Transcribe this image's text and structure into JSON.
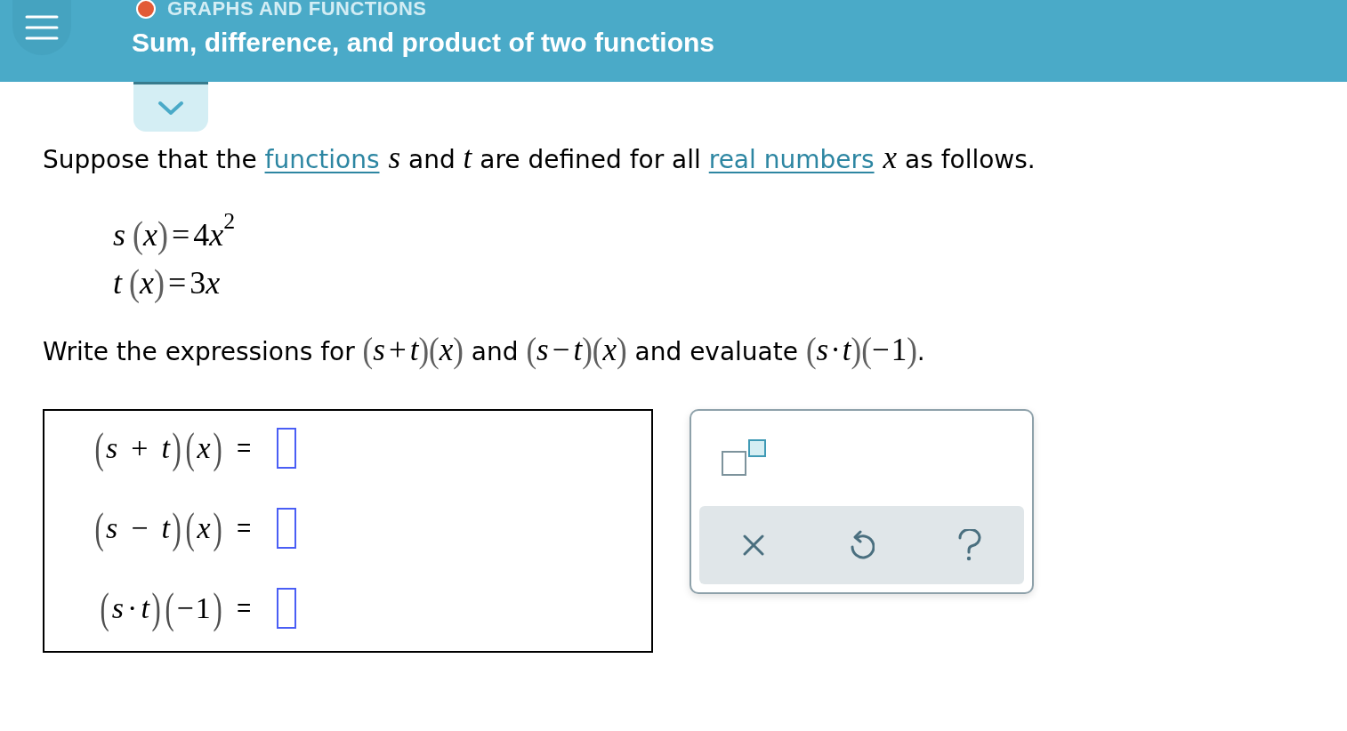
{
  "header": {
    "category": "GRAPHS AND FUNCTIONS",
    "title": "Sum, difference, and product of two functions"
  },
  "intro": [
    {
      "kind": "text",
      "text": "Suppose that the "
    },
    {
      "kind": "link",
      "text": "functions"
    },
    {
      "kind": "math",
      "tokens": [
        {
          "kind": "var",
          "text": "s"
        }
      ]
    },
    {
      "kind": "text",
      "text": " and "
    },
    {
      "kind": "math",
      "tokens": [
        {
          "kind": "var",
          "text": "t"
        }
      ]
    },
    {
      "kind": "text",
      "text": " are defined for all "
    },
    {
      "kind": "link",
      "text": "real numbers"
    },
    {
      "kind": "math",
      "tokens": [
        {
          "kind": "var",
          "text": "x"
        }
      ]
    },
    {
      "kind": "text",
      "text": " as follows."
    }
  ],
  "definitions": [
    [
      {
        "kind": "var",
        "text": "s"
      },
      {
        "kind": "paren",
        "text": "("
      },
      {
        "kind": "var",
        "text": "x"
      },
      {
        "kind": "paren",
        "text": ")"
      },
      {
        "kind": "op",
        "text": "="
      },
      {
        "kind": "num",
        "text": "4"
      },
      {
        "kind": "var",
        "text": "x"
      },
      {
        "kind": "sup",
        "text": "2"
      }
    ],
    [
      {
        "kind": "var",
        "text": "t"
      },
      {
        "kind": "paren",
        "text": "("
      },
      {
        "kind": "var",
        "text": "x"
      },
      {
        "kind": "paren",
        "text": ")"
      },
      {
        "kind": "op",
        "text": "="
      },
      {
        "kind": "num",
        "text": "3"
      },
      {
        "kind": "var",
        "text": "x"
      }
    ]
  ],
  "task": [
    {
      "kind": "text",
      "text": "Write the expressions for "
    },
    {
      "kind": "math",
      "tokens": [
        {
          "kind": "paren",
          "text": "("
        },
        {
          "kind": "var",
          "text": "s"
        },
        {
          "kind": "op",
          "text": "+"
        },
        {
          "kind": "var",
          "text": "t"
        },
        {
          "kind": "paren",
          "text": ")"
        },
        {
          "kind": "paren",
          "text": "("
        },
        {
          "kind": "var",
          "text": "x"
        },
        {
          "kind": "paren",
          "text": ")"
        }
      ]
    },
    {
      "kind": "text",
      "text": " and "
    },
    {
      "kind": "math",
      "tokens": [
        {
          "kind": "paren",
          "text": "("
        },
        {
          "kind": "var",
          "text": "s"
        },
        {
          "kind": "op",
          "text": "−"
        },
        {
          "kind": "var",
          "text": "t"
        },
        {
          "kind": "paren",
          "text": ")"
        },
        {
          "kind": "paren",
          "text": "("
        },
        {
          "kind": "var",
          "text": "x"
        },
        {
          "kind": "paren",
          "text": ")"
        }
      ]
    },
    {
      "kind": "text",
      "text": " and evaluate "
    },
    {
      "kind": "math",
      "tokens": [
        {
          "kind": "paren",
          "text": "("
        },
        {
          "kind": "var",
          "text": "s"
        },
        {
          "kind": "dot",
          "text": "·"
        },
        {
          "kind": "var",
          "text": "t"
        },
        {
          "kind": "paren",
          "text": ")"
        },
        {
          "kind": "paren",
          "text": "("
        },
        {
          "kind": "sign",
          "text": "−"
        },
        {
          "kind": "num",
          "text": "1"
        },
        {
          "kind": "paren",
          "text": ")"
        }
      ]
    },
    {
      "kind": "text",
      "text": "."
    }
  ],
  "answers": [
    {
      "expression": [
        {
          "kind": "paren",
          "text": "("
        },
        {
          "kind": "var",
          "text": "s"
        },
        {
          "kind": "op",
          "text": "+"
        },
        {
          "kind": "var",
          "text": "t"
        },
        {
          "kind": "paren",
          "text": ")"
        },
        {
          "kind": "paren",
          "text": "("
        },
        {
          "kind": "var",
          "text": "x"
        },
        {
          "kind": "paren",
          "text": ")"
        }
      ],
      "equals": "="
    },
    {
      "expression": [
        {
          "kind": "paren",
          "text": "("
        },
        {
          "kind": "var",
          "text": "s"
        },
        {
          "kind": "op",
          "text": "−"
        },
        {
          "kind": "var",
          "text": "t"
        },
        {
          "kind": "paren",
          "text": ")"
        },
        {
          "kind": "paren",
          "text": "("
        },
        {
          "kind": "var",
          "text": "x"
        },
        {
          "kind": "paren",
          "text": ")"
        }
      ],
      "equals": "="
    },
    {
      "expression": [
        {
          "kind": "paren",
          "text": "("
        },
        {
          "kind": "var",
          "text": "s"
        },
        {
          "kind": "dot",
          "text": "·"
        },
        {
          "kind": "var",
          "text": "t"
        },
        {
          "kind": "paren",
          "text": ")"
        },
        {
          "kind": "paren",
          "text": "("
        },
        {
          "kind": "sign",
          "text": "−"
        },
        {
          "kind": "num",
          "text": "1"
        },
        {
          "kind": "paren",
          "text": ")"
        }
      ],
      "equals": "="
    }
  ],
  "keypad": {
    "keys": [
      {
        "kind": "superscript"
      }
    ],
    "actions": [
      {
        "kind": "clear"
      },
      {
        "kind": "undo"
      },
      {
        "kind": "help"
      }
    ]
  }
}
